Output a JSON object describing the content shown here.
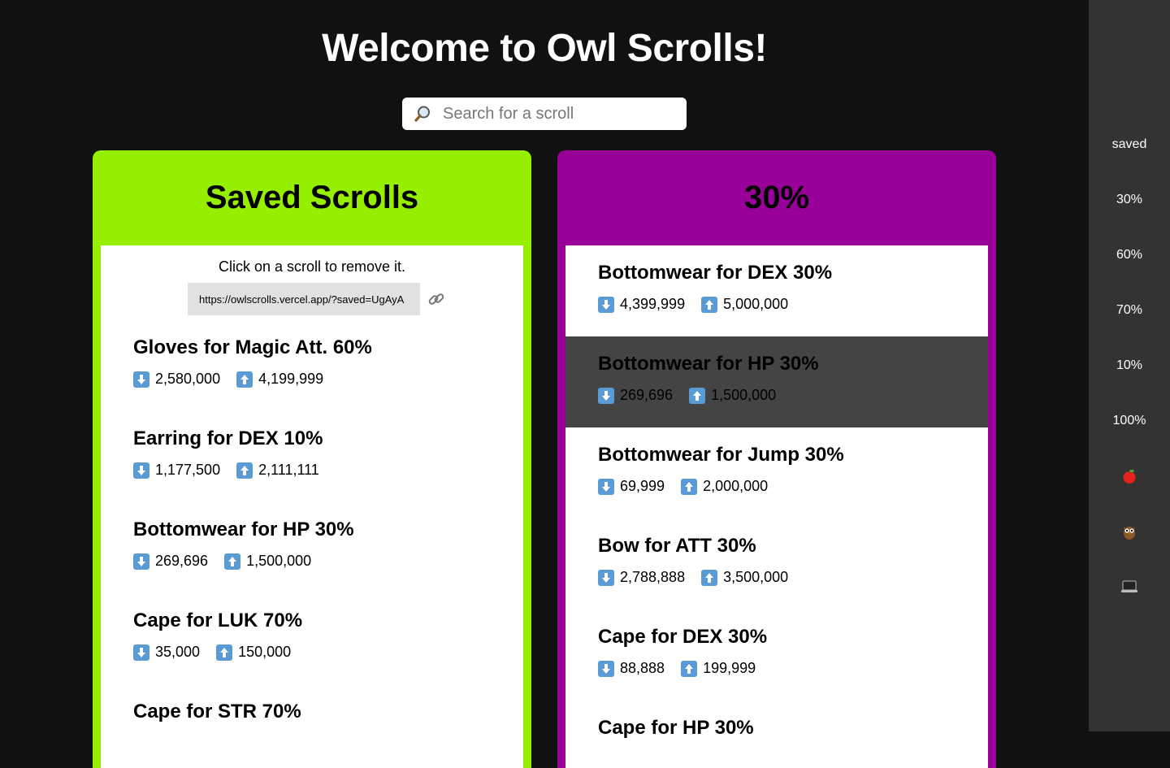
{
  "header": {
    "title": "Welcome to Owl Scrolls!"
  },
  "search": {
    "placeholder": "Search for a scroll",
    "icon": "magnifier-icon"
  },
  "saved_panel": {
    "title": "Saved Scrolls",
    "color": "#97ef00",
    "instructions": "Click on a scroll to remove it.",
    "share_url": "https://owlscrolls.vercel.app/?saved=UgAyA",
    "link_icon": "link-icon",
    "scrolls": [
      {
        "name": "Gloves for Magic Att. 60%",
        "low": "2,580,000",
        "high": "4,199,999"
      },
      {
        "name": "Earring for DEX 10%",
        "low": "1,177,500",
        "high": "2,111,111"
      },
      {
        "name": "Bottomwear for HP 30%",
        "low": "269,696",
        "high": "1,500,000"
      },
      {
        "name": "Cape for LUK 70%",
        "low": "35,000",
        "high": "150,000"
      },
      {
        "name": "Cape for STR 70%",
        "low": "",
        "high": ""
      }
    ]
  },
  "pct_panel": {
    "title": "30%",
    "color": "#990099",
    "scrolls": [
      {
        "name": "Bottomwear for DEX 30%",
        "low": "4,399,999",
        "high": "5,000,000"
      },
      {
        "name": "Bottomwear for HP 30%",
        "low": "269,696",
        "high": "1,500,000",
        "highlighted": true
      },
      {
        "name": "Bottomwear for Jump 30%",
        "low": "69,999",
        "high": "2,000,000"
      },
      {
        "name": "Bow for ATT 30%",
        "low": "2,788,888",
        "high": "3,500,000"
      },
      {
        "name": "Cape for DEX 30%",
        "low": "88,888",
        "high": "199,999"
      },
      {
        "name": "Cape for HP 30%",
        "low": "",
        "high": ""
      }
    ]
  },
  "sidebar": {
    "items": [
      {
        "label": "saved"
      },
      {
        "label": "30%"
      },
      {
        "label": "60%"
      },
      {
        "label": "70%"
      },
      {
        "label": "10%"
      },
      {
        "label": "100%"
      }
    ],
    "icons": [
      "apple-icon",
      "owl-icon",
      "laptop-icon"
    ]
  },
  "colors": {
    "background": "#111111",
    "sidebar": "#333333",
    "hover_row": "#444444",
    "arrow_badge": "#5b9bd5"
  }
}
